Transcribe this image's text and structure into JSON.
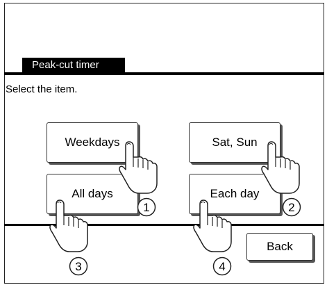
{
  "screen": {
    "title": "Peak-cut timer",
    "instruction": "Select the item."
  },
  "buttons": {
    "weekdays": "Weekdays",
    "sat_sun": "Sat, Sun",
    "all_days": "All days",
    "each_day": "Each day",
    "back": "Back"
  },
  "callouts": {
    "c1": "1",
    "c2": "2",
    "c3": "3",
    "c4": "4"
  },
  "icons": {
    "pointer": "pointing-hand-icon"
  }
}
